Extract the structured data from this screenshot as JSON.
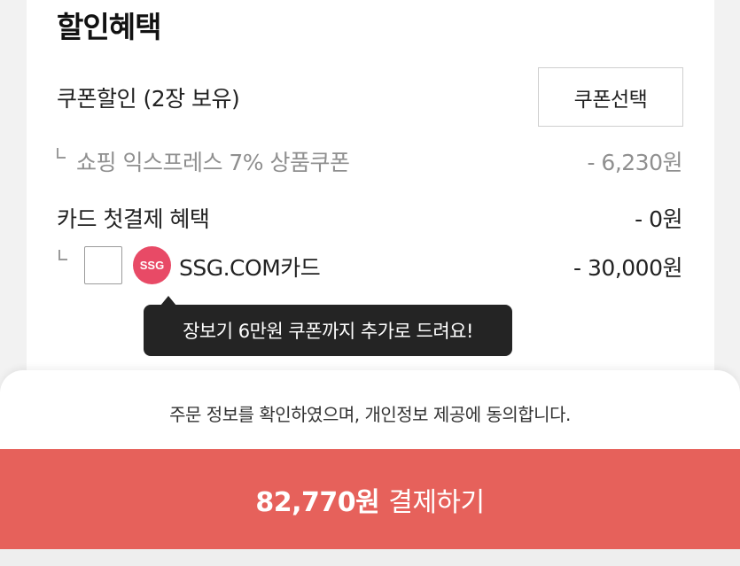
{
  "section": {
    "title": "할인혜택"
  },
  "coupon": {
    "label": "쿠폰할인 (2장 보유)",
    "select_button": "쿠폰선택",
    "applied_name": "쇼핑 익스프레스 7% 상품쿠폰",
    "applied_amount": "- 6,230원"
  },
  "card_benefit": {
    "label": "카드 첫결제 혜택",
    "amount": "- 0원",
    "card_logo_text": "SSG",
    "card_name": "SSG.COM카드",
    "card_amount": "- 30,000원",
    "checked": false
  },
  "tooltip": {
    "text": "장보기 6만원 쿠폰까지 추가로 드려요!"
  },
  "footer": {
    "agreement_text": "주문 정보를 확인하였으며, 개인정보 제공에 동의합니다.",
    "pay_amount": "82,770원",
    "pay_label": "결제하기"
  },
  "colors": {
    "pay_button": "#e6615b",
    "ssg_brand": "#e84a66",
    "tooltip_bg": "#242424"
  }
}
